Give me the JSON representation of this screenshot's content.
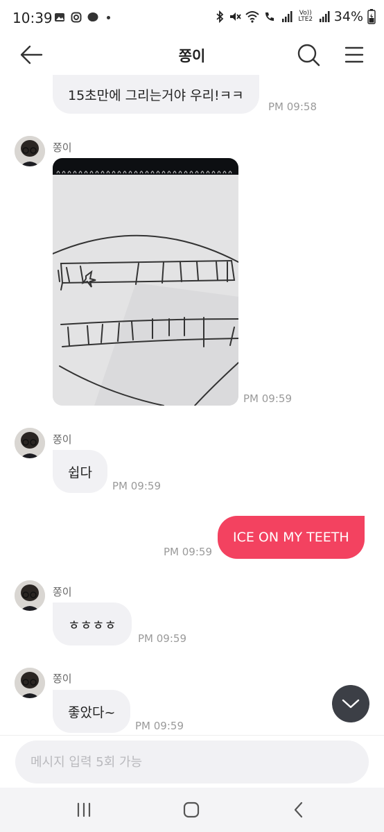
{
  "status_bar": {
    "time": "10:39",
    "battery": "34%",
    "volte_label": "Vo)) LTE2"
  },
  "header": {
    "title": "쫑이"
  },
  "messages": [
    {
      "direction": "in",
      "text": "15초만에 그리는거야 우리!ㅋㅋ",
      "time": "PM 09:58"
    },
    {
      "direction": "in",
      "sender": "쫑이",
      "type": "image",
      "time": "PM 09:59"
    },
    {
      "direction": "in",
      "sender": "쫑이",
      "text": "쉽다",
      "time": "PM 09:59"
    },
    {
      "direction": "out",
      "text": "ICE ON MY TEETH",
      "time": "PM 09:59"
    },
    {
      "direction": "in",
      "sender": "쫑이",
      "text": "ㅎㅎㅎㅎ",
      "time": "PM 09:59"
    },
    {
      "direction": "in",
      "sender": "쫑이",
      "text": "좋았다~",
      "time": "PM 09:59"
    }
  ],
  "input": {
    "placeholder": "메시지 입력 5회 가능"
  },
  "icons": {
    "back": "back-arrow-icon",
    "search": "search-icon",
    "menu": "menu-icon",
    "scroll": "chevron-down-icon"
  },
  "colors": {
    "outgoing_bubble": "#f34260",
    "incoming_bubble": "#f1f1f4",
    "scroll_button": "#3c3f46"
  }
}
